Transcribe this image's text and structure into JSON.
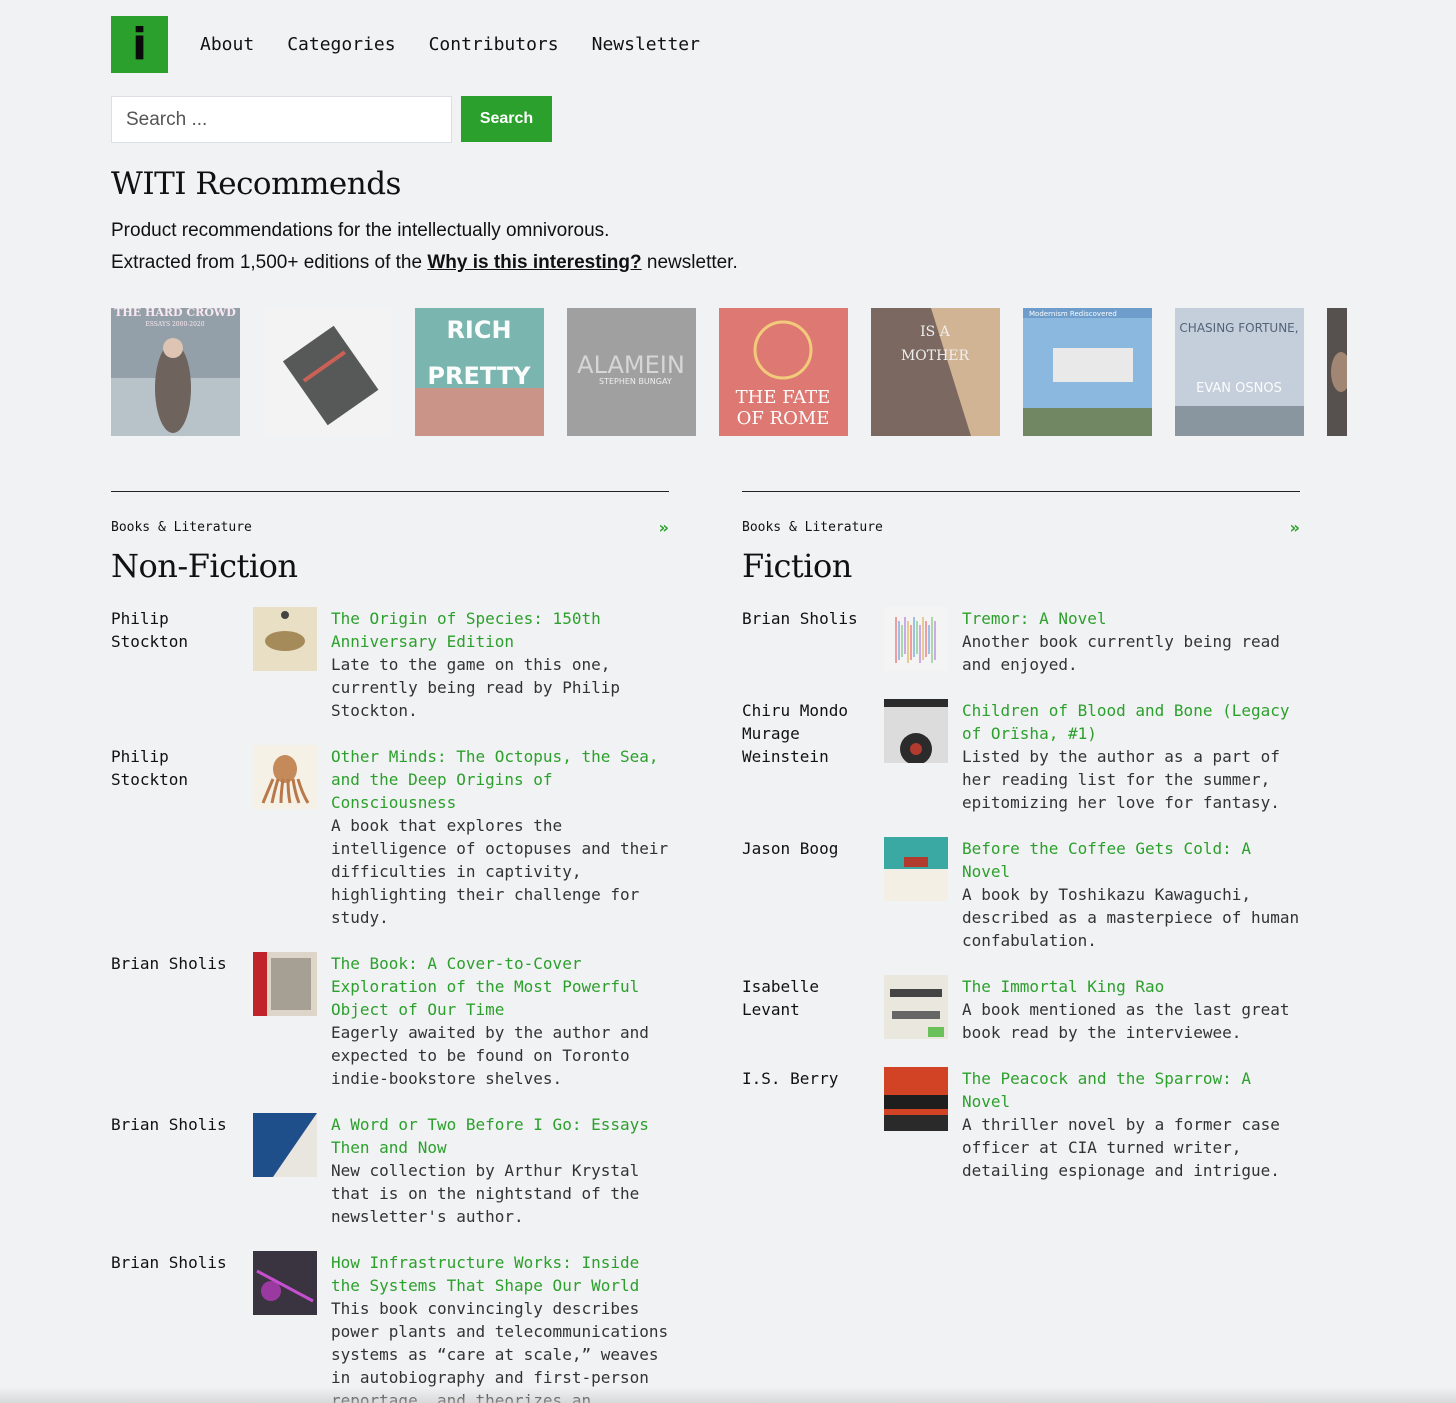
{
  "header": {
    "logo_text": "i",
    "nav": [
      "About",
      "Categories",
      "Contributors",
      "Newsletter"
    ]
  },
  "search": {
    "placeholder": "Search ...",
    "button": "Search"
  },
  "intro": {
    "title": "WITI Recommends",
    "line1": "Product recommendations for the intellectually omnivorous.",
    "line2_before": "Extracted from 1,500+ editions of the ",
    "line2_link": "Why is this interesting?",
    "line2_after": " newsletter."
  },
  "carousel": [
    {
      "text": "THE HARD CROWD",
      "sub": "ESSAYS 2000-2020",
      "bg": "#7a8a94"
    },
    {
      "text": "",
      "sub": "",
      "bg": "#f4f4f4"
    },
    {
      "text": "RICH",
      "sub": "PRETTY",
      "bg": "#5aa59e"
    },
    {
      "text": "ALAMEIN",
      "sub": "STEPHEN BUNGAY",
      "bg": "#8a8a8a"
    },
    {
      "text": "THE FATE",
      "sub": "OF ROME",
      "bg": "#d9574e"
    },
    {
      "text": "IS A",
      "sub": "MOTHER",
      "bg": "#5b4338"
    },
    {
      "text": "Modernism Rediscovered",
      "sub": "",
      "bg": "#4a86c0"
    },
    {
      "text": "CHASING FORTUNE,",
      "sub": "EVAN OSNOS",
      "bg": "#b8c6d4"
    },
    {
      "text": "",
      "sub": "",
      "bg": "#2b2520"
    }
  ],
  "columns": [
    {
      "category": "Books & Literature",
      "more": "»",
      "title": "Non-Fiction",
      "items": [
        {
          "who": "Philip Stockton",
          "title": "The Origin of Species: 150th Anniversary Edition",
          "desc": "Late to the game on this one, currently being read by Philip Stockton.",
          "thumb": "origin"
        },
        {
          "who": "Philip Stockton",
          "title": "Other Minds: The Octopus, the Sea, and the Deep Origins of Consciousness",
          "desc": "A book that explores the intelligence of octopuses and their difficulties in captivity, highlighting their challenge for study.",
          "thumb": "octopus"
        },
        {
          "who": "Brian Sholis",
          "title": "The Book: A Cover-to-Cover Exploration of the Most Powerful Object of Our Time",
          "desc": "Eagerly awaited by the author and expected to be found on Toronto indie-bookstore shelves.",
          "thumb": "book"
        },
        {
          "who": "Brian Sholis",
          "title": "A Word or Two Before I Go: Essays Then and Now",
          "desc": "New collection by Arthur Krystal that is on the nightstand of the newsletter's author.",
          "thumb": "word"
        },
        {
          "who": "Brian Sholis",
          "title": "How Infrastructure Works: Inside the Systems That Shape Our World",
          "desc": "This book convincingly describes power plants and telecommunications systems as “care at scale,” weaves in autobiography and first-person reportage, and theorizes an",
          "thumb": "infra"
        }
      ]
    },
    {
      "category": "Books & Literature",
      "more": "»",
      "title": "Fiction",
      "items": [
        {
          "who": "Brian Sholis",
          "title": "Tremor: A Novel",
          "desc": "Another book currently being read and enjoyed.",
          "thumb": "tremor"
        },
        {
          "who": "Chiru Mondo Murage Weinstein",
          "title": "Children of Blood and Bone (Legacy of Orïsha, #1)",
          "desc": "Listed by the author as a part of her reading list for the summer, epitomizing her love for fantasy.",
          "thumb": "blood"
        },
        {
          "who": "Jason Boog",
          "title": "Before the Coffee Gets Cold: A Novel",
          "desc": "A book by Toshikazu Kawaguchi, described as a masterpiece of human confabulation.",
          "thumb": "coffee"
        },
        {
          "who": "Isabelle Levant",
          "title": "The Immortal King Rao",
          "desc": "A book mentioned as the last great book read by the interviewee.",
          "thumb": "rao"
        },
        {
          "who": "I.S. Berry",
          "title": "The Peacock and the Sparrow: A Novel",
          "desc": "A thriller novel by a former case officer at CIA turned writer, detailing espionage and intrigue.",
          "thumb": "sparrow"
        }
      ]
    }
  ]
}
